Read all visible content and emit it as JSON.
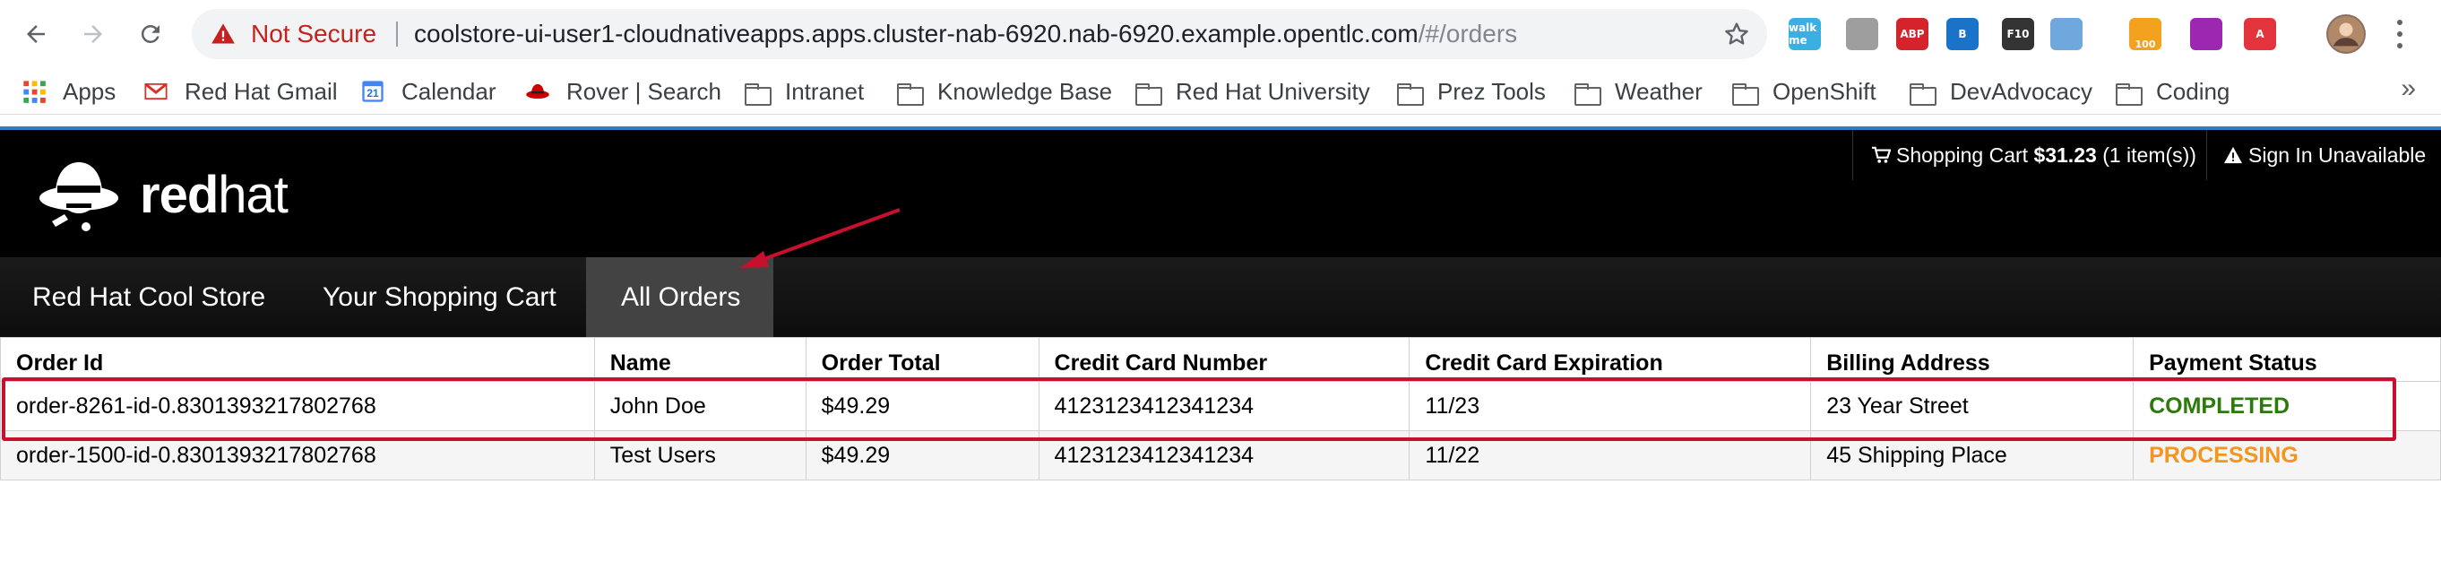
{
  "browser": {
    "security_label": "Not Secure",
    "url_host": "coolstore-ui-user1-cloudnativeapps.apps.cluster-nab-6920.nab-6920.example.opentlc.com",
    "url_path": "/#/orders",
    "extensions": [
      {
        "name": "walkme-extension-icon",
        "label": "walk me",
        "color": "#3ab0e2"
      },
      {
        "name": "drive-extension-icon",
        "label": "",
        "color": "#9e9e9e"
      },
      {
        "name": "adblock-extension-icon",
        "label": "ABP",
        "color": "#d4232b"
      },
      {
        "name": "bluejeans-extension-icon",
        "label": "B",
        "color": "#1a73c8"
      },
      {
        "name": "f10-extension-icon",
        "label": "F10",
        "color": "#333333"
      },
      {
        "name": "sphere-extension-icon",
        "label": "",
        "color": "#6fa8dc"
      },
      {
        "name": "rss-extension-icon",
        "label": "100",
        "color": "#f4a11f"
      },
      {
        "name": "color-wheel-extension-icon",
        "label": "",
        "color": "#9c27b0"
      },
      {
        "name": "pdf-extension-icon",
        "label": "A",
        "color": "#e3333d"
      }
    ],
    "badge_count": "100"
  },
  "bookmarks": [
    {
      "name": "bookmark-apps",
      "label": "Apps",
      "icon": "apps-grid-icon"
    },
    {
      "name": "bookmark-red-hat-gmail",
      "label": "Red Hat Gmail",
      "icon": "gmail-icon"
    },
    {
      "name": "bookmark-calendar",
      "label": "Calendar",
      "icon": "calendar-icon",
      "icon_text": "21"
    },
    {
      "name": "bookmark-rover-search",
      "label": "Rover | Search",
      "icon": "redhat-fedora-icon"
    },
    {
      "name": "bookmark-intranet",
      "label": "Intranet",
      "icon": "folder-icon"
    },
    {
      "name": "bookmark-knowledge-base",
      "label": "Knowledge Base",
      "icon": "folder-icon"
    },
    {
      "name": "bookmark-red-hat-university",
      "label": "Red Hat University",
      "icon": "folder-icon"
    },
    {
      "name": "bookmark-prez-tools",
      "label": "Prez Tools",
      "icon": "folder-icon"
    },
    {
      "name": "bookmark-weather",
      "label": "Weather",
      "icon": "folder-icon"
    },
    {
      "name": "bookmark-openshift",
      "label": "OpenShift",
      "icon": "folder-icon"
    },
    {
      "name": "bookmark-devadvocacy",
      "label": "DevAdvocacy",
      "icon": "folder-icon"
    },
    {
      "name": "bookmark-coding",
      "label": "Coding",
      "icon": "folder-icon"
    }
  ],
  "bookmarks_overflow": "»",
  "header": {
    "logo_text_bold": "red",
    "logo_text_regular": "hat",
    "cart_label": "Shopping Cart",
    "cart_total": "$31.23",
    "cart_items": "(1 item(s))",
    "signin_label": "Sign In Unavailable"
  },
  "nav": {
    "items": [
      {
        "label": "Red Hat Cool Store",
        "active": false
      },
      {
        "label": "Your Shopping Cart",
        "active": false
      },
      {
        "label": "All Orders",
        "active": true
      }
    ]
  },
  "orders": {
    "columns": [
      "Order Id",
      "Name",
      "Order Total",
      "Credit Card Number",
      "Credit Card Expiration",
      "Billing Address",
      "Payment Status"
    ],
    "rows": [
      [
        "order-8261-id-0.8301393217802768",
        "John Doe",
        "$49.29",
        "4123123412341234",
        "11/23",
        "23 Year Street",
        "COMPLETED"
      ],
      [
        "order-1500-id-0.8301393217802768",
        "Test Users",
        "$49.29",
        "4123123412341234",
        "11/22",
        "45 Shipping Place",
        "PROCESSING"
      ]
    ]
  },
  "colors": {
    "accent": "#2d7ec9",
    "status_completed": "#2b7a0b",
    "status_processing": "#f7941e",
    "annotation": "#c8102e"
  }
}
